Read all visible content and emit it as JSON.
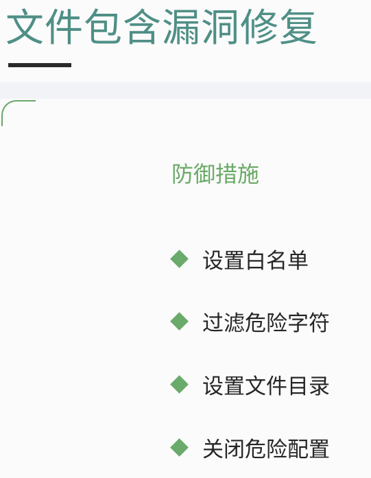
{
  "title": "文件包含漏洞修复",
  "subtitle": "防御措施",
  "items": [
    "设置白名单",
    "过滤危险字符",
    "设置文件目录",
    "关闭危险配置"
  ],
  "colors": {
    "title": "#4f8f86",
    "accent_green": "#6aaa6a",
    "underline": "#2a2a2a",
    "text": "#262626"
  }
}
